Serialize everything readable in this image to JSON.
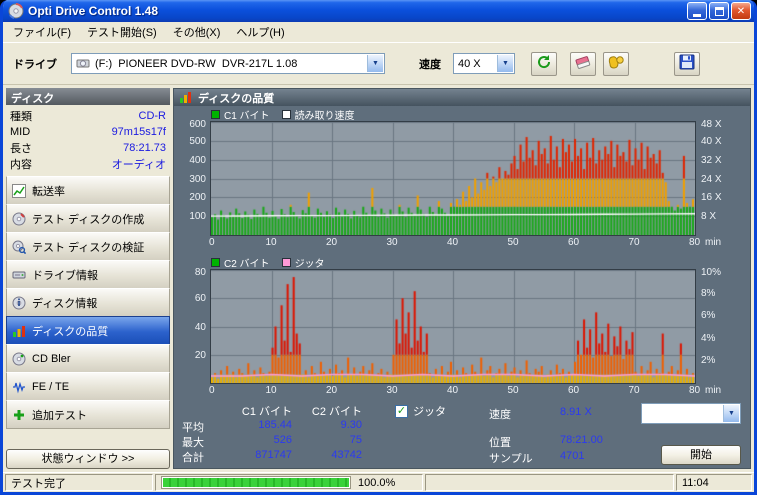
{
  "window": {
    "title": "Opti Drive Control 1.48"
  },
  "icons": {
    "app_icon": "optical-disc",
    "dropdown_arrow": "▼",
    "close_glyph": "✕",
    "minimize_button": "minimize-bar",
    "maximize_button": "maximize-box",
    "refresh_button": "refresh-arrows",
    "erase_button": "eraser",
    "clean_button": "gloves",
    "save_button": "floppy-disk",
    "check_mark": "✓"
  },
  "menu": {
    "file": "ファイル(F)",
    "start_test": "テスト開始(S)",
    "other": "その他(X)",
    "help": "ヘルプ(H)"
  },
  "toolbar": {
    "drive_label": "ドライブ",
    "drive_value": "(F:)  PIONEER DVD-RW  DVR-217L 1.08",
    "speed_label": "速度",
    "speed_value": "40 X"
  },
  "sidebar": {
    "header": "ディスク",
    "info": [
      {
        "label": "種類",
        "value": "CD-R"
      },
      {
        "label": "MID",
        "value": "97m15s17f"
      },
      {
        "label": "長さ",
        "value": "78:21.73"
      },
      {
        "label": "内容",
        "value": "オーディオ"
      }
    ],
    "buttons": [
      {
        "label": "転送率"
      },
      {
        "label": "テスト ディスクの作成"
      },
      {
        "label": "テスト ディスクの検証"
      },
      {
        "label": "ドライブ情報"
      },
      {
        "label": "ディスク情報"
      },
      {
        "label": "ディスクの品質",
        "active": true
      },
      {
        "label": "CD Bler"
      },
      {
        "label": "FE / TE"
      },
      {
        "label": "追加テスト"
      }
    ],
    "status_window_button": "状態ウィンドウ >>"
  },
  "content": {
    "header": "ディスクの品質",
    "stats": {
      "col_c1": "C1 バイト",
      "col_c2": "C2 バイト",
      "row_avg_label": "平均",
      "avg_c1": "185.44",
      "avg_c2": "9.30",
      "row_max_label": "最大",
      "max_c1": "526",
      "max_c2": "75",
      "row_total_label": "合計",
      "total_c1": "871747",
      "total_c2": "43742",
      "jitter_label": "ジッタ",
      "jitter_checked": true,
      "speed_label": "速度",
      "speed_value": "8.91 X",
      "position_label": "位置",
      "position_value": "78:21.00",
      "sample_label": "サンプル",
      "sample_value": "4701",
      "speed_select": "40 X",
      "start_button": "開始"
    }
  },
  "statusbar": {
    "status": "テスト完了",
    "progress_percent": "100.0%",
    "time": "11:04"
  },
  "colors": {
    "title_blue": "#0b50dc",
    "panel_slate": "#5f6e7c",
    "value_blue": "#2b3af0",
    "progress_green": "#3ad23a"
  },
  "chart_data": [
    {
      "type": "bar",
      "name": "c1-and-read-speed",
      "legend": [
        {
          "label": "C1 バイト",
          "color": "#00b400"
        },
        {
          "label": "読み取り速度",
          "color": "#ffffff"
        }
      ],
      "ylim_left": [
        0,
        600
      ],
      "yticks_left": [
        600,
        500,
        400,
        300,
        200,
        100
      ],
      "yticks_right": [
        {
          "label": "48 X",
          "value": 600
        },
        {
          "label": "40 X",
          "value": 500
        },
        {
          "label": "32 X",
          "value": 400
        },
        {
          "label": "24 X",
          "value": 300
        },
        {
          "label": "16 X",
          "value": 200
        },
        {
          "label": "8 X",
          "value": 100
        }
      ],
      "xticks": [
        0,
        10,
        20,
        30,
        40,
        50,
        60,
        70,
        80
      ],
      "x_unit": "min",
      "zones": [
        {
          "upTo": 150,
          "color": "#18a818"
        },
        {
          "upTo": 300,
          "color": "#f0a000"
        },
        {
          "upTo": 600,
          "color": "#e02500"
        }
      ],
      "line_color": "#ffffff",
      "bars": [
        95,
        110,
        82,
        130,
        105,
        88,
        120,
        98,
        140,
        115,
        90,
        125,
        108,
        85,
        135,
        112,
        96,
        150,
        118,
        92,
        128,
        104,
        86,
        138,
        110,
        95,
        160,
        122,
        100,
        88,
        132,
        115,
        225,
        105,
        92,
        140,
        118,
        96,
        126,
        108,
        90,
        145,
        120,
        98,
        135,
        112,
        88,
        128,
        106,
        94,
        150,
        118,
        102,
        250,
        130,
        96,
        140,
        115,
        92,
        135,
        110,
        100,
        160,
        125,
        95,
        145,
        118,
        105,
        210,
        135,
        112,
        96,
        150,
        122,
        108,
        180,
        140,
        118,
        104,
        170,
        150,
        190,
        160,
        230,
        180,
        260,
        200,
        300,
        220,
        280,
        240,
        330,
        260,
        310,
        280,
        360,
        300,
        340,
        320,
        380,
        420,
        350,
        480,
        390,
        520,
        410,
        450,
        370,
        500,
        430,
        460,
        380,
        526,
        400,
        470,
        360,
        510,
        440,
        480,
        390,
        510,
        420,
        460,
        350,
        490,
        410,
        515,
        380,
        450,
        400,
        470,
        430,
        500,
        360,
        480,
        420,
        440,
        390,
        505,
        370,
        460,
        400,
        490,
        350,
        470,
        410,
        430,
        380,
        450,
        330,
        280,
        180,
        150,
        130,
        160,
        140,
        420,
        170,
        150,
        190
      ],
      "line": [
        100,
        101,
        102,
        103,
        103,
        104,
        105,
        106,
        106,
        107,
        108,
        108,
        109,
        110,
        111,
        112,
        113
      ]
    },
    {
      "type": "bar",
      "name": "c2-and-jitter",
      "legend": [
        {
          "label": "C2 バイト",
          "color": "#00b400"
        },
        {
          "label": "ジッタ",
          "color": "#ff9ad8"
        }
      ],
      "ylim_left": [
        0,
        80
      ],
      "yticks_left": [
        80,
        60,
        40,
        20
      ],
      "yticks_right": [
        {
          "label": "10%",
          "value": 80
        },
        {
          "label": "8%",
          "value": 64
        },
        {
          "label": "6%",
          "value": 48
        },
        {
          "label": "4%",
          "value": 32
        },
        {
          "label": "2%",
          "value": 16
        }
      ],
      "xticks": [
        0,
        10,
        20,
        30,
        40,
        50,
        60,
        70,
        80
      ],
      "x_unit": "min",
      "zones": [
        {
          "upTo": 6,
          "color": "#e8b000"
        },
        {
          "upTo": 20,
          "color": "#f06000"
        },
        {
          "upTo": 80,
          "color": "#dd1500"
        }
      ],
      "line_color": "#ff9ad8",
      "bars": [
        4,
        7,
        3,
        9,
        5,
        12,
        6,
        8,
        4,
        10,
        7,
        5,
        14,
        6,
        9,
        4,
        11,
        7,
        5,
        8,
        25,
        40,
        18,
        55,
        30,
        70,
        22,
        75,
        35,
        28,
        6,
        9,
        4,
        12,
        7,
        5,
        15,
        8,
        6,
        10,
        5,
        13,
        7,
        9,
        4,
        18,
        6,
        11,
        5,
        8,
        12,
        6,
        9,
        14,
        5,
        7,
        10,
        4,
        8,
        6,
        20,
        45,
        28,
        60,
        35,
        50,
        25,
        65,
        30,
        40,
        22,
        35,
        7,
        4,
        10,
        6,
        12,
        5,
        8,
        15,
        6,
        9,
        4,
        11,
        7,
        5,
        13,
        8,
        6,
        18,
        5,
        9,
        12,
        4,
        7,
        10,
        6,
        14,
        5,
        8,
        11,
        4,
        9,
        6,
        16,
        7,
        5,
        10,
        8,
        12,
        4,
        6,
        9,
        5,
        13,
        7,
        10,
        4,
        8,
        6,
        15,
        30,
        20,
        45,
        25,
        38,
        18,
        50,
        28,
        35,
        22,
        42,
        19,
        33,
        26,
        40,
        17,
        30,
        24,
        36,
        8,
        5,
        12,
        6,
        9,
        15,
        4,
        10,
        7,
        35,
        6,
        8,
        12,
        5,
        9,
        28,
        6,
        10,
        4,
        7
      ],
      "line": [
        5,
        5,
        6,
        5,
        6,
        6,
        5,
        6,
        5,
        6,
        6,
        5,
        6,
        5,
        6,
        6,
        5
      ]
    }
  ]
}
